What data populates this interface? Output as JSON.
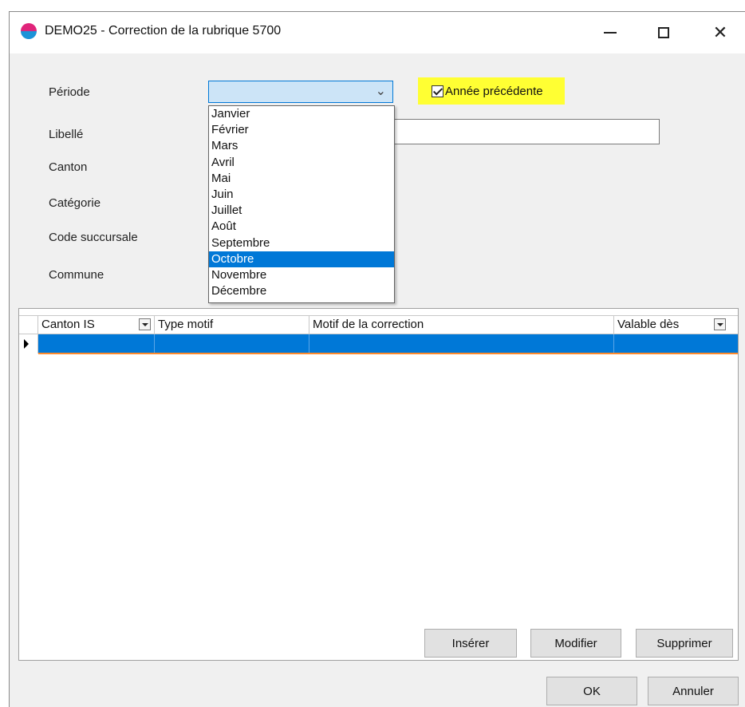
{
  "window": {
    "title": "DEMO25 - Correction de la rubrique 5700"
  },
  "form": {
    "periode_label": "Période",
    "libelle_label": "Libellé",
    "canton_label": "Canton",
    "categorie_label": "Catégorie",
    "code_succursale_label": "Code succursale",
    "commune_label": "Commune",
    "periode_value": "",
    "annee_precedente_label": "Année précédente",
    "annee_precedente_checked": true,
    "libelle_value": ""
  },
  "dropdown": {
    "items": [
      "Janvier",
      "Février",
      "Mars",
      "Avril",
      "Mai",
      "Juin",
      "Juillet",
      "Août",
      "Septembre",
      "Octobre",
      "Novembre",
      "Décembre"
    ],
    "highlighted": "Octobre"
  },
  "grid": {
    "columns": [
      "Canton IS",
      "Type motif",
      "Motif de la correction",
      "Valable dès"
    ]
  },
  "buttons": {
    "inserer": "Insérer",
    "modifier": "Modifier",
    "supprimer": "Supprimer",
    "ok": "OK",
    "annuler": "Annuler"
  },
  "colors": {
    "accent": "#0078d7",
    "highlight": "#ffff33",
    "row_underline": "#ff8a2b"
  },
  "icons": {
    "app": "app-logo-icon",
    "minimize": "minimize-icon",
    "maximize": "maximize-icon",
    "close": "close-icon",
    "dropdown": "chevron-down-icon",
    "filter": "filter-dropdown-icon",
    "row": "row-indicator-icon"
  }
}
